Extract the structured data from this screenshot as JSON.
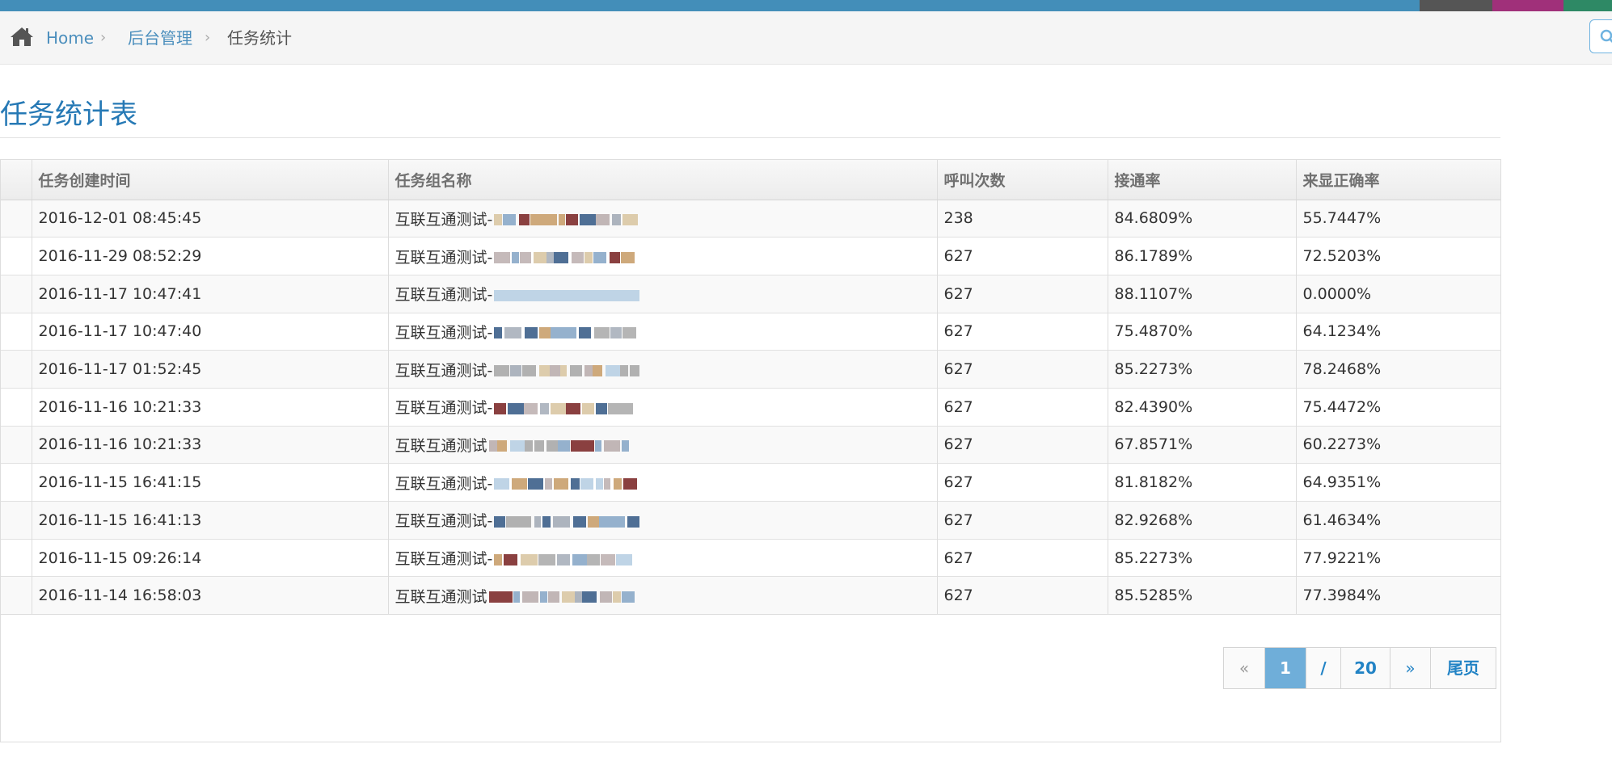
{
  "breadcrumb": {
    "home": "Home",
    "admin": "后台管理",
    "current": "任务统计",
    "separator": "›"
  },
  "page": {
    "title": "任务统计表"
  },
  "table": {
    "headers": [
      "",
      "任务创建时间",
      "任务组名称",
      "呼叫次数",
      "接通率",
      "来显正确率"
    ],
    "rows": [
      {
        "created": "2016-12-01 08:45:45",
        "group_prefix": "互联互通测试-",
        "calls": "238",
        "connect_rate": "84.6809%",
        "caller_id_rate": "55.7447%"
      },
      {
        "created": "2016-11-29 08:52:29",
        "group_prefix": "互联互通测试-",
        "calls": "627",
        "connect_rate": "86.1789%",
        "caller_id_rate": "72.5203%"
      },
      {
        "created": "2016-11-17 10:47:41",
        "group_prefix": "互联互通测试-",
        "calls": "627",
        "connect_rate": "88.1107%",
        "caller_id_rate": "0.0000%"
      },
      {
        "created": "2016-11-17 10:47:40",
        "group_prefix": "互联互通测试-",
        "calls": "627",
        "connect_rate": "75.4870%",
        "caller_id_rate": "64.1234%"
      },
      {
        "created": "2016-11-17 01:52:45",
        "group_prefix": "互联互通测试-",
        "calls": "627",
        "connect_rate": "85.2273%",
        "caller_id_rate": "78.2468%"
      },
      {
        "created": "2016-11-16 10:21:33",
        "group_prefix": "互联互通测试-",
        "calls": "627",
        "connect_rate": "82.4390%",
        "caller_id_rate": "75.4472%"
      },
      {
        "created": "2016-11-16 10:21:33",
        "group_prefix": "互联互通测试",
        "calls": "627",
        "connect_rate": "67.8571%",
        "caller_id_rate": "60.2273%"
      },
      {
        "created": "2016-11-15 16:41:15",
        "group_prefix": "互联互通测试-",
        "calls": "627",
        "connect_rate": "81.8182%",
        "caller_id_rate": "64.9351%"
      },
      {
        "created": "2016-11-15 16:41:13",
        "group_prefix": "互联互通测试-",
        "calls": "627",
        "connect_rate": "82.9268%",
        "caller_id_rate": "61.4634%"
      },
      {
        "created": "2016-11-15 09:26:14",
        "group_prefix": "互联互通测试-",
        "calls": "627",
        "connect_rate": "85.2273%",
        "caller_id_rate": "77.9221%"
      },
      {
        "created": "2016-11-14 16:58:03",
        "group_prefix": "互联互通测试",
        "calls": "627",
        "connect_rate": "85.5285%",
        "caller_id_rate": "77.3984%"
      }
    ]
  },
  "pagination": {
    "prev": "«",
    "current": "1",
    "slash": "/",
    "total": "20",
    "next": "»",
    "last": "尾页"
  },
  "icons": {
    "home": "home-icon",
    "search": "search-icon"
  },
  "colors": {
    "topbar": "#438eb9",
    "link": "#4c8fbd",
    "title": "#2679b5",
    "pager_active": "#6faed9"
  }
}
